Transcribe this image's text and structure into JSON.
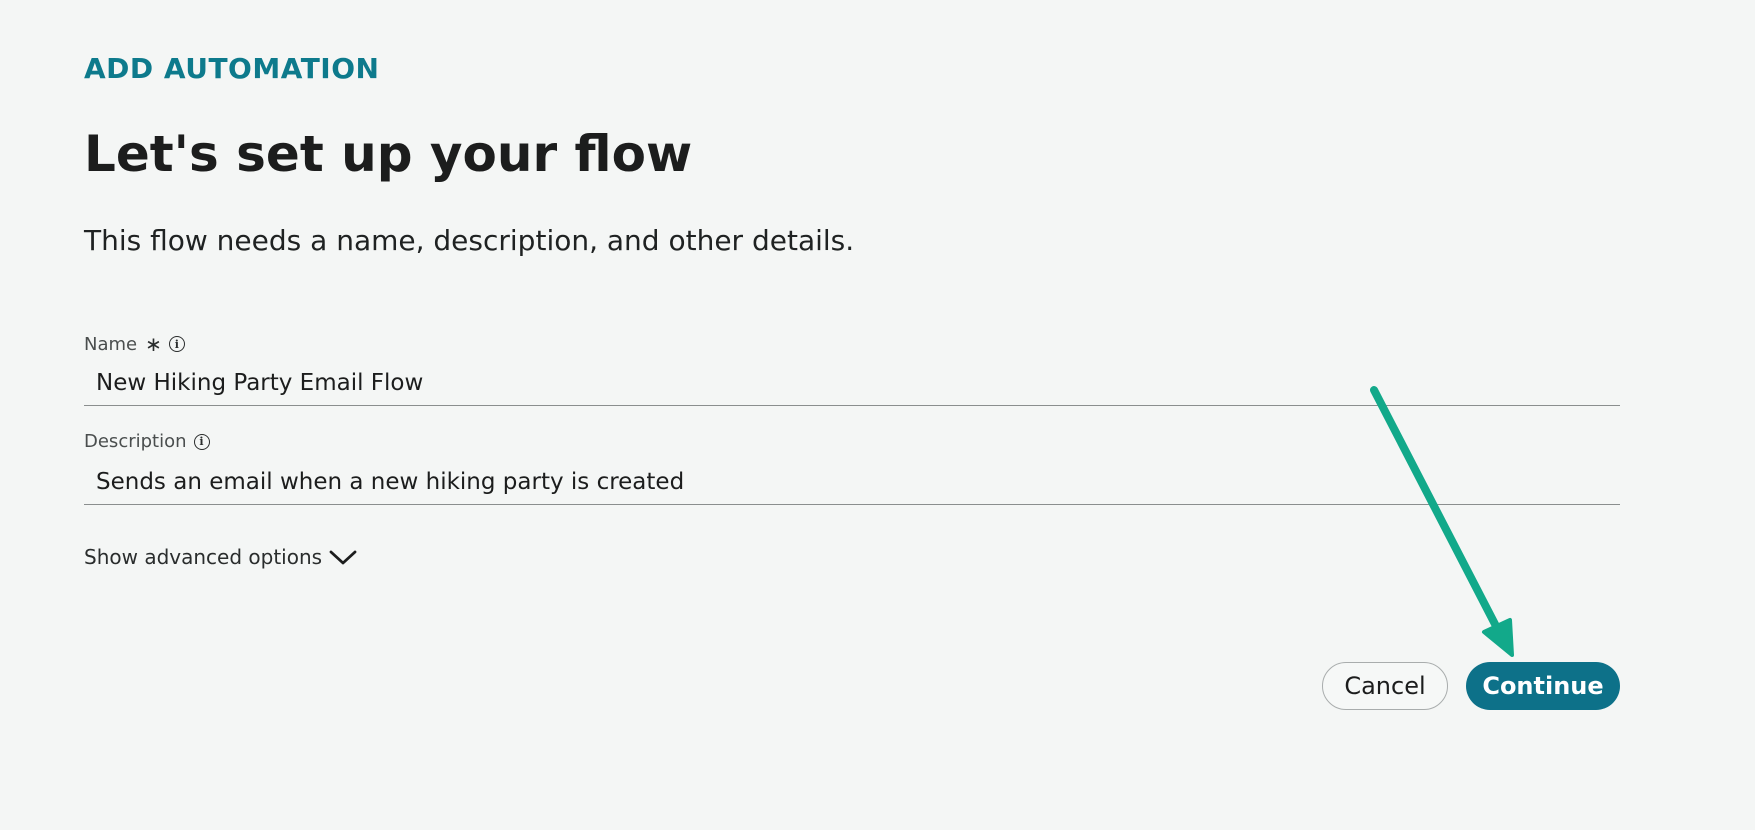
{
  "header": {
    "eyebrow": "ADD AUTOMATION",
    "title": "Let's set up your flow",
    "subtitle": "This flow needs a name, description, and other details."
  },
  "form": {
    "name": {
      "label": "Name",
      "required_mark": "∗",
      "value": "New Hiking Party Email Flow"
    },
    "description": {
      "label": "Description",
      "value": "Sends an email when a new hiking party is created"
    },
    "advanced_toggle": "Show advanced options"
  },
  "actions": {
    "cancel_label": "Cancel",
    "continue_label": "Continue"
  },
  "icons": {
    "info": "info-circle-icon",
    "chevron": "chevron-down-icon",
    "annotation": "annotation-arrow"
  },
  "colors": {
    "accent": "#0d7189",
    "eyebrow": "#0d7a8c",
    "annotation_arrow": "#12a98a",
    "background": "#f4f6f5"
  }
}
